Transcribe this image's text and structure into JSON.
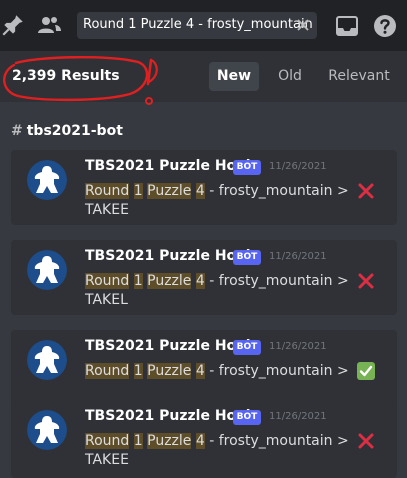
{
  "toolbar": {
    "search_query": "Round 1 Puzzle 4 - frosty_mountain"
  },
  "results": {
    "count": "2,399 Results",
    "sort_options": {
      "new": "New",
      "old": "Old",
      "relevant": "Relevant"
    },
    "selected_sort": "New"
  },
  "channel": {
    "hash": "#",
    "name": "tbs2021-bot"
  },
  "messages": [
    {
      "author": "TBS2021 Puzzle Hook",
      "badge": "BOT",
      "timestamp": "11/26/2021",
      "w1": "Round",
      "w2": "1",
      "w3": "Puzzle",
      "w4": "4",
      "rest": " - frosty_mountain > ",
      "reaction": "cross-mark-icon",
      "line2": "TAKEE"
    },
    {
      "author": "TBS2021 Puzzle Hook",
      "badge": "BOT",
      "timestamp": "11/26/2021",
      "w1": "Round",
      "w2": "1",
      "w3": "Puzzle",
      "w4": "4",
      "rest": " - frosty_mountain > ",
      "reaction": "cross-mark-icon",
      "line2": "TAKEL"
    },
    {
      "author": "TBS2021 Puzzle Hook",
      "badge": "BOT",
      "timestamp": "11/26/2021",
      "w1": "Round",
      "w2": "1",
      "w3": "Puzzle",
      "w4": "4",
      "rest": " - frosty_mountain > ",
      "reaction": "check-mark-icon",
      "line2": ""
    },
    {
      "author": "TBS2021 Puzzle Hook",
      "badge": "BOT",
      "timestamp": "11/26/2021",
      "w1": "Round",
      "w2": "1",
      "w3": "Puzzle",
      "w4": "4",
      "rest": " - frosty_mountain > ",
      "reaction": "cross-mark-icon",
      "line2": "TAKEE"
    }
  ],
  "colors": {
    "highlight": "#5e4d29",
    "bot_badge": "#5865f2",
    "cross": "#dd2e44",
    "check": "#77b255",
    "annotation": "#e02020"
  }
}
